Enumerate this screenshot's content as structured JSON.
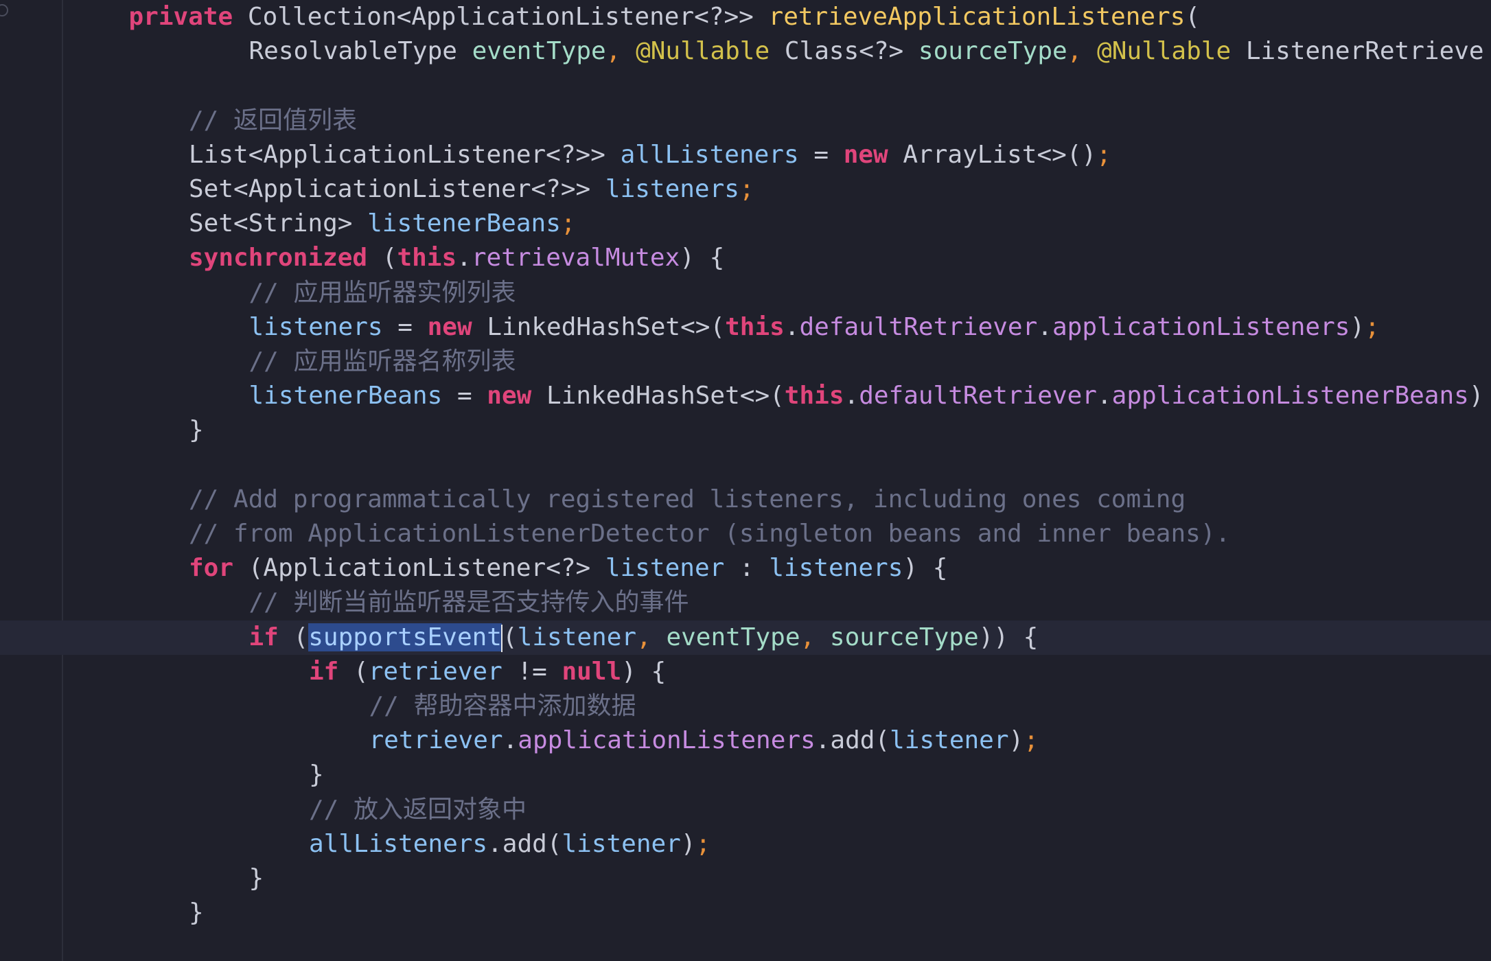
{
  "editor": {
    "lines": [
      {
        "indent": 2,
        "tokens": [
          {
            "t": "private",
            "c": "kw"
          },
          {
            "t": " ",
            "c": "plain"
          },
          {
            "t": "Collection<ApplicationListener<?>>",
            "c": "type"
          },
          {
            "t": " ",
            "c": "plain"
          },
          {
            "t": "retrieveApplicationListeners",
            "c": "fn"
          },
          {
            "t": "(",
            "c": "punc"
          }
        ]
      },
      {
        "indent": 4,
        "tokens": [
          {
            "t": "ResolvableType",
            "c": "type"
          },
          {
            "t": " ",
            "c": "plain"
          },
          {
            "t": "eventType",
            "c": "param"
          },
          {
            "t": ",",
            "c": "comma"
          },
          {
            "t": " ",
            "c": "plain"
          },
          {
            "t": "@Nullable",
            "c": "ann"
          },
          {
            "t": " ",
            "c": "plain"
          },
          {
            "t": "Class<?>",
            "c": "type"
          },
          {
            "t": " ",
            "c": "plain"
          },
          {
            "t": "sourceType",
            "c": "param"
          },
          {
            "t": ",",
            "c": "comma"
          },
          {
            "t": " ",
            "c": "plain"
          },
          {
            "t": "@Nullable",
            "c": "ann"
          },
          {
            "t": " ",
            "c": "plain"
          },
          {
            "t": "ListenerRetrieve",
            "c": "type"
          }
        ]
      },
      {
        "indent": 0,
        "tokens": []
      },
      {
        "indent": 3,
        "tokens": [
          {
            "t": "// 返回值列表",
            "c": "cmt"
          }
        ]
      },
      {
        "indent": 3,
        "tokens": [
          {
            "t": "List<ApplicationListener<?>>",
            "c": "type"
          },
          {
            "t": " ",
            "c": "plain"
          },
          {
            "t": "allListeners",
            "c": "var"
          },
          {
            "t": " = ",
            "c": "punc"
          },
          {
            "t": "new",
            "c": "kw"
          },
          {
            "t": " ",
            "c": "plain"
          },
          {
            "t": "ArrayList<>()",
            "c": "type"
          },
          {
            "t": ";",
            "c": "semi"
          }
        ]
      },
      {
        "indent": 3,
        "tokens": [
          {
            "t": "Set<ApplicationListener<?>>",
            "c": "type"
          },
          {
            "t": " ",
            "c": "plain"
          },
          {
            "t": "listeners",
            "c": "var"
          },
          {
            "t": ";",
            "c": "semi"
          }
        ]
      },
      {
        "indent": 3,
        "tokens": [
          {
            "t": "Set<String>",
            "c": "type"
          },
          {
            "t": " ",
            "c": "plain"
          },
          {
            "t": "listenerBeans",
            "c": "var"
          },
          {
            "t": ";",
            "c": "semi"
          }
        ]
      },
      {
        "indent": 3,
        "tokens": [
          {
            "t": "synchronized",
            "c": "kw"
          },
          {
            "t": " (",
            "c": "punc"
          },
          {
            "t": "this",
            "c": "kw"
          },
          {
            "t": ".",
            "c": "punc"
          },
          {
            "t": "retrievalMutex",
            "c": "field"
          },
          {
            "t": ") {",
            "c": "punc"
          }
        ]
      },
      {
        "indent": 4,
        "tokens": [
          {
            "t": "// 应用监听器实例列表",
            "c": "cmt"
          }
        ]
      },
      {
        "indent": 4,
        "tokens": [
          {
            "t": "listeners",
            "c": "var"
          },
          {
            "t": " = ",
            "c": "punc"
          },
          {
            "t": "new",
            "c": "kw"
          },
          {
            "t": " ",
            "c": "plain"
          },
          {
            "t": "LinkedHashSet<>(",
            "c": "type"
          },
          {
            "t": "this",
            "c": "kw"
          },
          {
            "t": ".",
            "c": "punc"
          },
          {
            "t": "defaultRetriever",
            "c": "field"
          },
          {
            "t": ".",
            "c": "punc"
          },
          {
            "t": "applicationListeners",
            "c": "field"
          },
          {
            "t": ")",
            "c": "punc"
          },
          {
            "t": ";",
            "c": "semi"
          }
        ]
      },
      {
        "indent": 4,
        "tokens": [
          {
            "t": "// 应用监听器名称列表",
            "c": "cmt"
          }
        ]
      },
      {
        "indent": 4,
        "tokens": [
          {
            "t": "listenerBeans",
            "c": "var"
          },
          {
            "t": " = ",
            "c": "punc"
          },
          {
            "t": "new",
            "c": "kw"
          },
          {
            "t": " ",
            "c": "plain"
          },
          {
            "t": "LinkedHashSet<>(",
            "c": "type"
          },
          {
            "t": "this",
            "c": "kw"
          },
          {
            "t": ".",
            "c": "punc"
          },
          {
            "t": "defaultRetriever",
            "c": "field"
          },
          {
            "t": ".",
            "c": "punc"
          },
          {
            "t": "applicationListenerBeans",
            "c": "field"
          },
          {
            "t": ")",
            "c": "punc"
          }
        ]
      },
      {
        "indent": 3,
        "tokens": [
          {
            "t": "}",
            "c": "punc"
          }
        ]
      },
      {
        "indent": 0,
        "tokens": []
      },
      {
        "indent": 3,
        "tokens": [
          {
            "t": "// Add programmatically registered listeners, including ones coming",
            "c": "cmt"
          }
        ]
      },
      {
        "indent": 3,
        "tokens": [
          {
            "t": "// from ApplicationListenerDetector (singleton beans and inner beans).",
            "c": "cmt"
          }
        ]
      },
      {
        "indent": 3,
        "tokens": [
          {
            "t": "for",
            "c": "kw"
          },
          {
            "t": " (",
            "c": "punc"
          },
          {
            "t": "ApplicationListener<?>",
            "c": "type"
          },
          {
            "t": " ",
            "c": "plain"
          },
          {
            "t": "listener",
            "c": "var"
          },
          {
            "t": " : ",
            "c": "punc"
          },
          {
            "t": "listeners",
            "c": "var"
          },
          {
            "t": ") {",
            "c": "punc"
          }
        ]
      },
      {
        "indent": 4,
        "tokens": [
          {
            "t": "// 判断当前监听器是否支持传入的事件",
            "c": "cmt"
          }
        ]
      },
      {
        "indent": 4,
        "current": true,
        "tokens": [
          {
            "t": "if",
            "c": "kw"
          },
          {
            "t": " (",
            "c": "punc"
          },
          {
            "t": "supportsEvent",
            "c": "sel"
          },
          {
            "caret": true
          },
          {
            "t": "(",
            "c": "punc"
          },
          {
            "t": "listener",
            "c": "var"
          },
          {
            "t": ",",
            "c": "comma"
          },
          {
            "t": " ",
            "c": "plain"
          },
          {
            "t": "eventType",
            "c": "param"
          },
          {
            "t": ",",
            "c": "comma"
          },
          {
            "t": " ",
            "c": "plain"
          },
          {
            "t": "sourceType",
            "c": "param"
          },
          {
            "t": ")) {",
            "c": "punc"
          }
        ]
      },
      {
        "indent": 5,
        "tokens": [
          {
            "t": "if",
            "c": "kw"
          },
          {
            "t": " (",
            "c": "punc"
          },
          {
            "t": "retriever",
            "c": "var"
          },
          {
            "t": " != ",
            "c": "punc"
          },
          {
            "t": "null",
            "c": "kw"
          },
          {
            "t": ") {",
            "c": "punc"
          }
        ]
      },
      {
        "indent": 6,
        "tokens": [
          {
            "t": "// 帮助容器中添加数据",
            "c": "cmt"
          }
        ]
      },
      {
        "indent": 6,
        "tokens": [
          {
            "t": "retriever",
            "c": "var"
          },
          {
            "t": ".",
            "c": "punc"
          },
          {
            "t": "applicationListeners",
            "c": "field"
          },
          {
            "t": ".add(",
            "c": "punc"
          },
          {
            "t": "listener",
            "c": "var"
          },
          {
            "t": ")",
            "c": "punc"
          },
          {
            "t": ";",
            "c": "semi"
          }
        ]
      },
      {
        "indent": 5,
        "tokens": [
          {
            "t": "}",
            "c": "punc"
          }
        ]
      },
      {
        "indent": 5,
        "tokens": [
          {
            "t": "// 放入返回对象中",
            "c": "cmt"
          }
        ]
      },
      {
        "indent": 5,
        "tokens": [
          {
            "t": "allListeners",
            "c": "var"
          },
          {
            "t": ".add(",
            "c": "punc"
          },
          {
            "t": "listener",
            "c": "var"
          },
          {
            "t": ")",
            "c": "punc"
          },
          {
            "t": ";",
            "c": "semi"
          }
        ]
      },
      {
        "indent": 4,
        "tokens": [
          {
            "t": "}",
            "c": "punc"
          }
        ]
      },
      {
        "indent": 3,
        "tokens": [
          {
            "t": "}",
            "c": "punc"
          }
        ]
      }
    ]
  }
}
